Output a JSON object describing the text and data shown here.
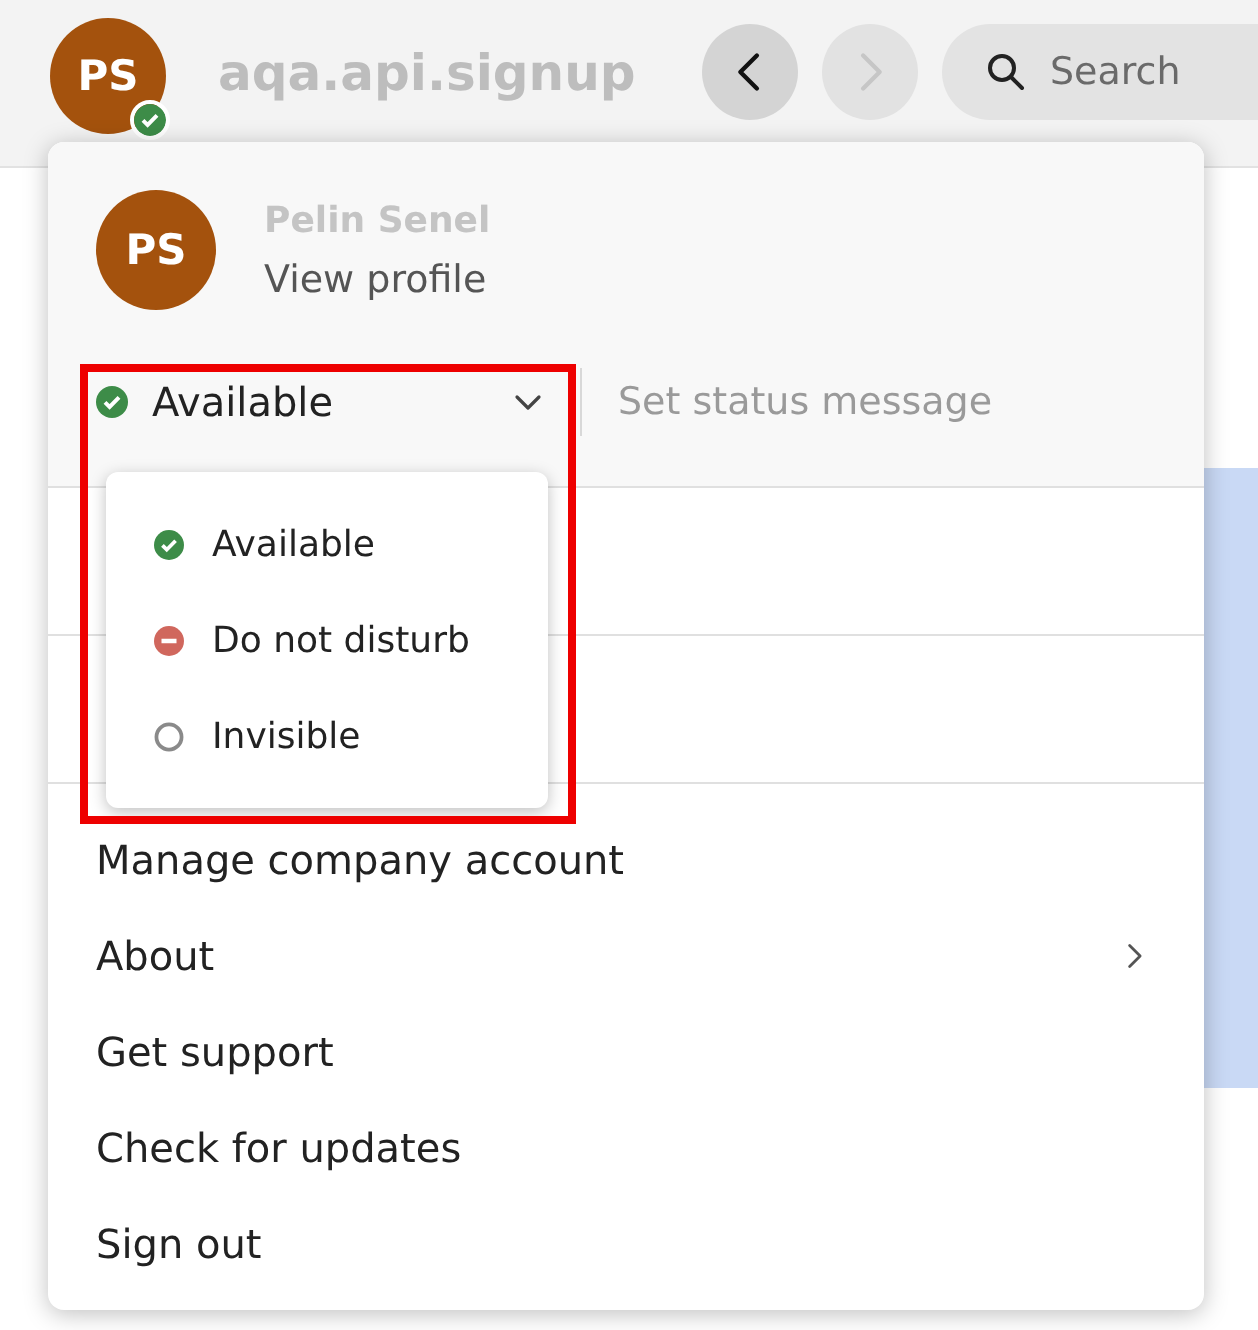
{
  "app_bar": {
    "avatar_initials": "PS",
    "presence": {
      "kind": "available"
    },
    "title": "aqa.api.signup",
    "back_disabled": false,
    "forward_disabled": true,
    "search": {
      "placeholder": "Search"
    }
  },
  "account_menu": {
    "avatar_initials": "PS",
    "user_name": "Pelin Senel",
    "view_profile": "View profile",
    "status": {
      "label": "Available",
      "kind": "available",
      "expanded": true
    },
    "status_message": {
      "placeholder": "Set status message"
    },
    "status_options": [
      {
        "label": "Available",
        "kind": "available"
      },
      {
        "label": "Do not disturb",
        "kind": "dnd"
      },
      {
        "label": "Invisible",
        "kind": "invisible"
      }
    ],
    "items": [
      {
        "label": "Manage company account",
        "submenu": false
      },
      {
        "label": "About",
        "submenu": true
      },
      {
        "label": "Get support",
        "submenu": false
      },
      {
        "label": "Check for updates",
        "submenu": false
      },
      {
        "label": "Sign out",
        "submenu": false
      }
    ]
  }
}
